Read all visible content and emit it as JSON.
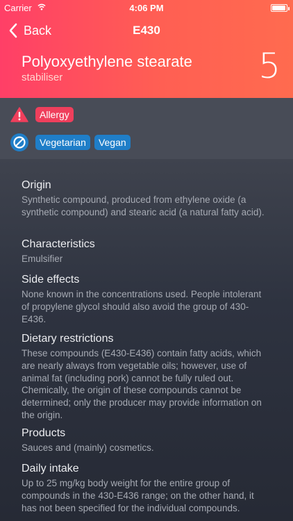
{
  "status": {
    "carrier": "Carrier",
    "time": "4:06 PM"
  },
  "nav": {
    "back": "Back",
    "title": "E430"
  },
  "header": {
    "name": "Polyoxyethylene stearate",
    "category": "stabiliser",
    "score": "5"
  },
  "warnings": {
    "allergy_tags": [
      "Allergy"
    ],
    "diet_tags": [
      "Vegetarian",
      "Vegan"
    ]
  },
  "sections": [
    {
      "heading": "Origin",
      "body": "Synthetic compound, produced from ethylene oxide (a synthetic compound) and stearic acid (a natural fatty acid)."
    },
    {
      "heading": "Characteristics",
      "body": "Emulsifier"
    },
    {
      "heading": "Side effects",
      "body": "None known in the concentrations used. People intolerant of propylene glycol should also avoid the group of 430-E436."
    },
    {
      "heading": "Dietary restrictions",
      "body": "These compounds (E430-E436) contain fatty acids, which are nearly always from vegetable oils; however, use of animal fat (including pork) cannot be fully ruled out. Chemically, the origin of these compounds cannot be determined; only the producer may provide information on the origin."
    },
    {
      "heading": "Products",
      "body": "Sauces and (mainly) cosmetics."
    },
    {
      "heading": "Daily intake",
      "body": "Up to 25 mg/kg body weight for the entire group of compounds in the 430-E436 range; on the other hand, it has not been specified for the individual compounds."
    }
  ],
  "colors": {
    "header_start": "#ff3f67",
    "header_end": "#ff6b4f",
    "allergy": "#ef3f5c",
    "diet": "#1f7ec8"
  },
  "icons": [
    "wifi-icon",
    "battery-icon",
    "back-chevron-icon",
    "warning-triangle-icon",
    "prohibited-icon"
  ]
}
